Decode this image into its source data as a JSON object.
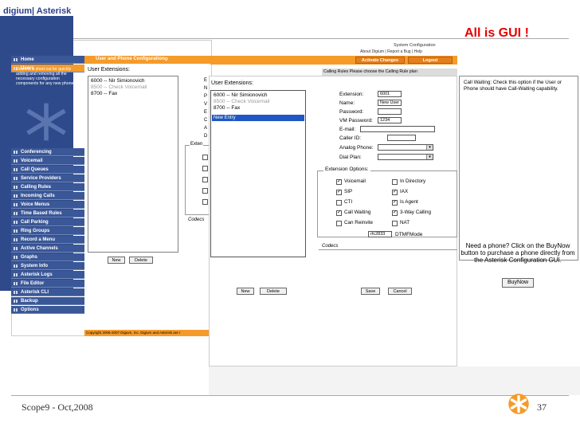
{
  "slide": {
    "title": "All is GUI !",
    "footer": "Scope9 - Oct,2008",
    "page_number": "37"
  },
  "colors": {
    "accent_orange": "#f59b2a",
    "nav_blue": "#2f4a8a",
    "title_red": "#e60000",
    "selection_blue": "#1f57c4"
  },
  "left_shot": {
    "brand": "digium| Asterisk",
    "nav_items": [
      "Home",
      "Users",
      "Conferencing",
      "Voicemail",
      "Call Queues",
      "Service Providers",
      "Calling Rules",
      "Incoming Calls",
      "Voice Menus",
      "Time Based Rules",
      "Call Parking",
      "Ring Groups",
      "Record a Menu",
      "Active Channels",
      "Graphs",
      "System Info",
      "Asterisk Logs",
      "File Editor",
      "Asterisk CLI",
      "Backup",
      "Options"
    ],
    "users_description": "Users is a short cut for quickly adding and removing all the necessary configuration components for any new phone.",
    "page_heading": "User and Phone Configuration",
    "ext_heading": "User Extensions:",
    "extensions": [
      {
        "text": "6000 -- Nir Simionovich",
        "muted": false
      },
      {
        "text": "8500 -- Check Voicemail",
        "muted": true
      },
      {
        "text": "8700 -- Fax",
        "muted": false
      }
    ],
    "new_button": "New",
    "delete_button": "Delete",
    "copyright": "Copyright 2006-2007 Digium, Inc. Digium and Asterisk are r",
    "cut_labels": [
      "E",
      "N",
      "P",
      "V",
      "E",
      "C",
      "A",
      "D",
      "Exten",
      "Codecs"
    ]
  },
  "header_shot": {
    "system_config": "System Configuration",
    "links": "About Digium | Report a Bug | Help",
    "apply_button": "Activate Changes",
    "reload_button": "Logout",
    "calling_rule_note": "Calling Rules Please choose the Calling Rule plan"
  },
  "editor_shot": {
    "ext_heading": "User Extensions:",
    "extensions": [
      "6000 -- Nir Simionovich",
      "8500 -- Check Voicemail",
      "8700 -- Fax"
    ],
    "new_entry": "New Entry",
    "new_button": "New",
    "delete_button": "Delete",
    "save_button": "Save",
    "cancel_button": "Cancel",
    "fields": [
      {
        "label": "Extension:",
        "value": "6001"
      },
      {
        "label": "Name:",
        "value": "New User"
      },
      {
        "label": "Password:",
        "value": ""
      },
      {
        "label": "VM Password:",
        "value": "1234"
      },
      {
        "label": "E-mail:",
        "value": ""
      },
      {
        "label": "Caller ID:",
        "value": ""
      },
      {
        "label": "Analog Phone:",
        "value": ""
      },
      {
        "label": "Dial Plan:",
        "value": ""
      }
    ],
    "options_legend": "Extension Options:",
    "options": [
      {
        "label": "Voicemail",
        "checked": true
      },
      {
        "label": "In Directory",
        "checked": false
      },
      {
        "label": "SIP",
        "checked": true
      },
      {
        "label": "IAX",
        "checked": true
      },
      {
        "label": "CTI",
        "checked": false
      },
      {
        "label": "Is Agent",
        "checked": true
      },
      {
        "label": "Call Waiting",
        "checked": true
      },
      {
        "label": "3-Way Calling",
        "checked": true
      },
      {
        "label": "Can Reinvite",
        "checked": false
      },
      {
        "label": "NAT",
        "checked": false
      }
    ],
    "dtmf_value": "rfc2833",
    "dtmf_label": "DTMFMode",
    "codecs_label": "Codecs"
  },
  "help_panel": {
    "call_waiting_text": "Call Waiting: Check this option if the User or Phone should have Call-Waiting capability.",
    "buy_text": "Need a phone? Click on the BuyNow button to purchase a phone directly from the Asterisk Configuration GUI.",
    "buy_button": "BuyNow"
  }
}
